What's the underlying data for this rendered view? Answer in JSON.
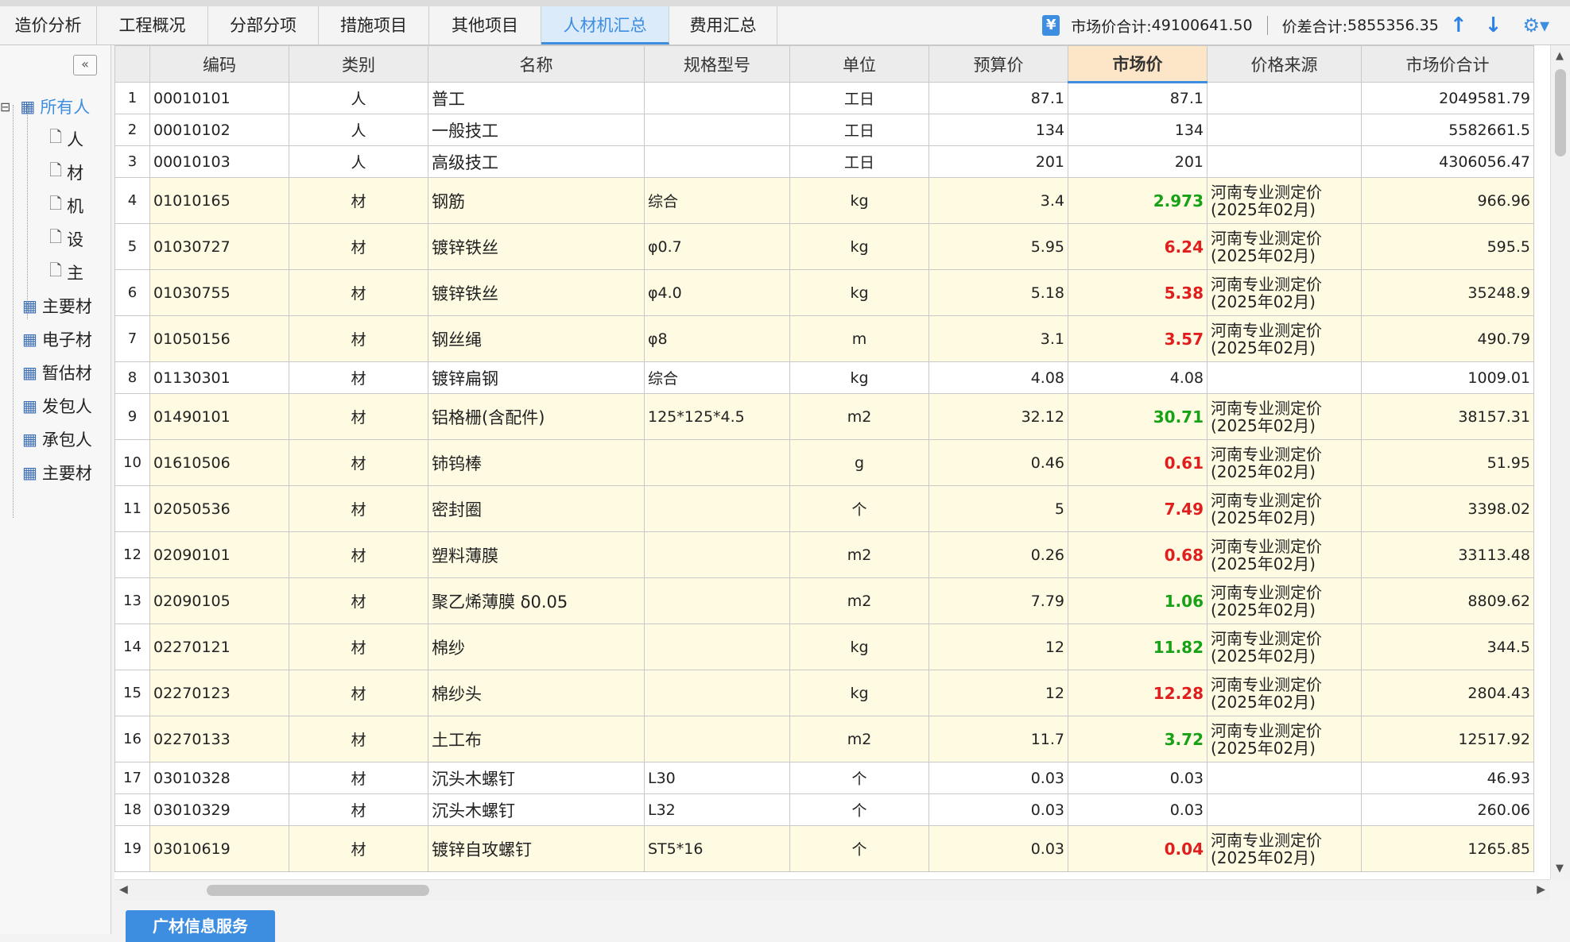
{
  "tabs": [
    "造价分析",
    "工程概况",
    "分部分项",
    "措施项目",
    "其他项目",
    "人材机汇总",
    "费用汇总"
  ],
  "active_tab": "人材机汇总",
  "summary": {
    "market_total_label": "市场价合计:",
    "market_total_value": "49100641.50",
    "diff_total_label": "价差合计:",
    "diff_total_value": "5855356.35"
  },
  "tree": {
    "items": [
      "所有人",
      "人",
      "材",
      "机",
      "设",
      "主",
      "主要材",
      "电子材",
      "暂估材",
      "发包人",
      "承包人",
      "主要材"
    ]
  },
  "grid": {
    "columns": [
      "编码",
      "类别",
      "名称",
      "规格型号",
      "单位",
      "预算价",
      "市场价",
      "价格来源",
      "市场价合计"
    ],
    "rows": [
      {
        "idx": "1",
        "code": "00010101",
        "type": "人",
        "name": "普工",
        "spec": "",
        "unit": "工日",
        "budget": "87.1",
        "market": "87.1",
        "source": "",
        "total": "2049581.79",
        "trend": ""
      },
      {
        "idx": "2",
        "code": "00010102",
        "type": "人",
        "name": "一般技工",
        "spec": "",
        "unit": "工日",
        "budget": "134",
        "market": "134",
        "source": "",
        "total": "5582661.5",
        "trend": ""
      },
      {
        "idx": "3",
        "code": "00010103",
        "type": "人",
        "name": "高级技工",
        "spec": "",
        "unit": "工日",
        "budget": "201",
        "market": "201",
        "source": "",
        "total": "4306056.47",
        "trend": ""
      },
      {
        "idx": "4",
        "code": "01010165",
        "type": "材",
        "name": "钢筋",
        "spec": "综合",
        "unit": "kg",
        "budget": "3.4",
        "market": "2.973",
        "source": "河南专业测定价(2025年02月)",
        "total": "966.96",
        "trend": "down"
      },
      {
        "idx": "5",
        "code": "01030727",
        "type": "材",
        "name": "镀锌铁丝",
        "spec": "φ0.7",
        "unit": "kg",
        "budget": "5.95",
        "market": "6.24",
        "source": "河南专业测定价(2025年02月)",
        "total": "595.5",
        "trend": "up"
      },
      {
        "idx": "6",
        "code": "01030755",
        "type": "材",
        "name": "镀锌铁丝",
        "spec": "φ4.0",
        "unit": "kg",
        "budget": "5.18",
        "market": "5.38",
        "source": "河南专业测定价(2025年02月)",
        "total": "35248.9",
        "trend": "up"
      },
      {
        "idx": "7",
        "code": "01050156",
        "type": "材",
        "name": "钢丝绳",
        "spec": "φ8",
        "unit": "m",
        "budget": "3.1",
        "market": "3.57",
        "source": "河南专业测定价(2025年02月)",
        "total": "490.79",
        "trend": "up"
      },
      {
        "idx": "8",
        "code": "01130301",
        "type": "材",
        "name": "镀锌扁钢",
        "spec": "综合",
        "unit": "kg",
        "budget": "4.08",
        "market": "4.08",
        "source": "",
        "total": "1009.01",
        "trend": ""
      },
      {
        "idx": "9",
        "code": "01490101",
        "type": "材",
        "name": "铝格栅(含配件)",
        "spec": "125*125*4.5",
        "unit": "m2",
        "budget": "32.12",
        "market": "30.71",
        "source": "河南专业测定价(2025年02月)",
        "total": "38157.31",
        "trend": "down"
      },
      {
        "idx": "10",
        "code": "01610506",
        "type": "材",
        "name": "铈钨棒",
        "spec": "",
        "unit": "g",
        "budget": "0.46",
        "market": "0.61",
        "source": "河南专业测定价(2025年02月)",
        "total": "51.95",
        "trend": "up"
      },
      {
        "idx": "11",
        "code": "02050536",
        "type": "材",
        "name": "密封圈",
        "spec": "",
        "unit": "个",
        "budget": "5",
        "market": "7.49",
        "source": "河南专业测定价(2025年02月)",
        "total": "3398.02",
        "trend": "up"
      },
      {
        "idx": "12",
        "code": "02090101",
        "type": "材",
        "name": "塑料薄膜",
        "spec": "",
        "unit": "m2",
        "budget": "0.26",
        "market": "0.68",
        "source": "河南专业测定价(2025年02月)",
        "total": "33113.48",
        "trend": "up"
      },
      {
        "idx": "13",
        "code": "02090105",
        "type": "材",
        "name": "聚乙烯薄膜 δ0.05",
        "spec": "",
        "unit": "m2",
        "budget": "7.79",
        "market": "1.06",
        "source": "河南专业测定价(2025年02月)",
        "total": "8809.62",
        "trend": "down"
      },
      {
        "idx": "14",
        "code": "02270121",
        "type": "材",
        "name": "棉纱",
        "spec": "",
        "unit": "kg",
        "budget": "12",
        "market": "11.82",
        "source": "河南专业测定价(2025年02月)",
        "total": "344.5",
        "trend": "down"
      },
      {
        "idx": "15",
        "code": "02270123",
        "type": "材",
        "name": "棉纱头",
        "spec": "",
        "unit": "kg",
        "budget": "12",
        "market": "12.28",
        "source": "河南专业测定价(2025年02月)",
        "total": "2804.43",
        "trend": "up"
      },
      {
        "idx": "16",
        "code": "02270133",
        "type": "材",
        "name": "土工布",
        "spec": "",
        "unit": "m2",
        "budget": "11.7",
        "market": "3.72",
        "source": "河南专业测定价(2025年02月)",
        "total": "12517.92",
        "trend": "down"
      },
      {
        "idx": "17",
        "code": "03010328",
        "type": "材",
        "name": "沉头木螺钉",
        "spec": "L30",
        "unit": "个",
        "budget": "0.03",
        "market": "0.03",
        "source": "",
        "total": "46.93",
        "trend": ""
      },
      {
        "idx": "18",
        "code": "03010329",
        "type": "材",
        "name": "沉头木螺钉",
        "spec": "L32",
        "unit": "个",
        "budget": "0.03",
        "market": "0.03",
        "source": "",
        "total": "260.06",
        "trend": ""
      },
      {
        "idx": "19",
        "code": "03010619",
        "type": "材",
        "name": "镀锌自攻螺钉",
        "spec": "ST5*16",
        "unit": "个",
        "budget": "0.03",
        "market": "0.04",
        "source": "河南专业测定价(2025年02月)",
        "total": "1265.85",
        "trend": "up"
      }
    ]
  },
  "bottom_button": "广材信息服务",
  "colors": {
    "accent": "#3d8ee0",
    "up": "#e01e1e",
    "down": "#17a117",
    "highlight_row": "#fffbe3"
  }
}
